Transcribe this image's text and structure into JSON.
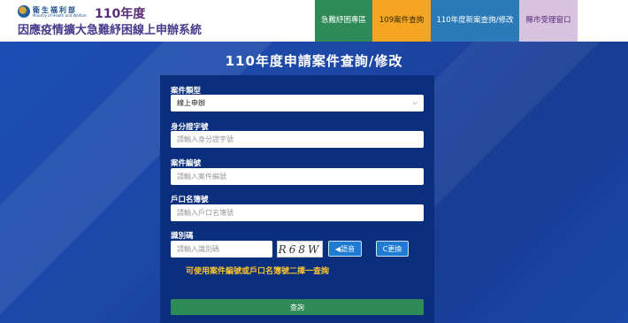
{
  "header": {
    "ministry_cn": "衛生福利部",
    "ministry_en": "Ministry of Health and Welfare",
    "year": "110年度",
    "system_title": "因應疫情擴大急難紓困線上申辦系統"
  },
  "nav": [
    {
      "label": "急難紓困專區"
    },
    {
      "label": "109案件查詢"
    },
    {
      "label": "110年度新案查詢/修改"
    },
    {
      "label": "縣市受理窗口"
    }
  ],
  "page_title": "110年度申請案件查詢/修改",
  "form": {
    "case_type": {
      "label": "案件類型",
      "value": "線上申辦"
    },
    "id_number": {
      "label": "身分證字號",
      "placeholder": "請輸入身分證字號"
    },
    "case_number": {
      "label": "案件編號",
      "placeholder": "請輸入案件編號"
    },
    "household_number": {
      "label": "戶口名簿號",
      "placeholder": "請輸入戶口名簿號"
    },
    "captcha": {
      "label": "識別碼",
      "placeholder": "請輸入識別碼",
      "image_text": "R68W",
      "voice_label": "◀語音",
      "refresh_label": "C更換"
    },
    "hint": "可使用案件編號或戶口名簿號二擇一查詢",
    "submit_label": "查詢"
  },
  "colors": {
    "nav1": "#2e8b57",
    "nav2": "#f4a623",
    "nav3": "#2a7ab8",
    "nav4": "#d7c3df",
    "background": "#1b4fb3",
    "card": "#0b2f7c",
    "hint": "#f6c331",
    "submit": "#2e8b57"
  },
  "icons": {
    "logo": "ministry-logo-icon",
    "select_arrow": "chevron-down-icon",
    "voice": "speaker-icon",
    "refresh": "refresh-icon"
  }
}
